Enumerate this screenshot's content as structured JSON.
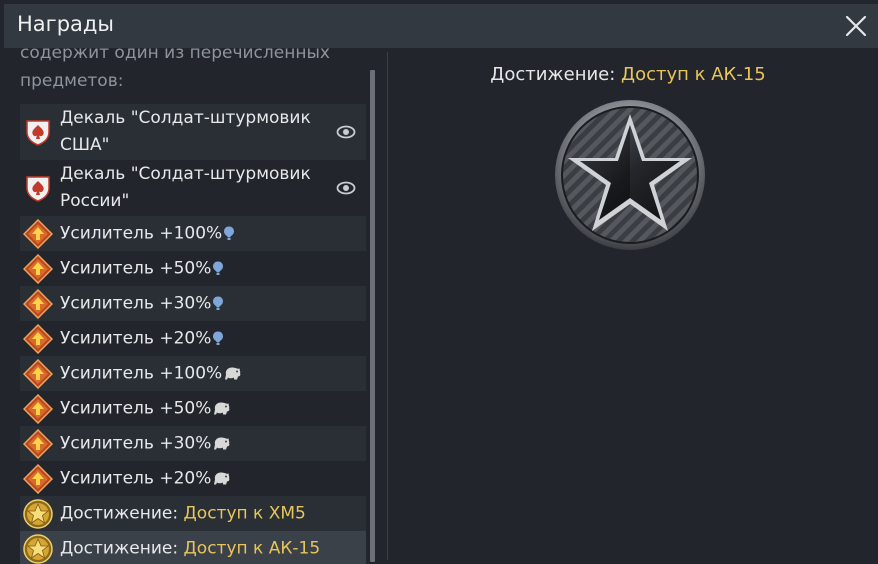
{
  "window": {
    "title": "Награды"
  },
  "intro": "содержит один из перечисленных предметов:",
  "items": [
    {
      "kind": "decal",
      "text": "Декаль \"Солдат-штурмовик США\"",
      "highlight": "",
      "suffix": "",
      "eye": true
    },
    {
      "kind": "decal",
      "text": "Декаль \"Солдат-штурмовик России\"",
      "highlight": "",
      "suffix": "",
      "eye": true
    },
    {
      "kind": "booster",
      "text": "Усилитель +100%",
      "highlight": "",
      "suffix": "rp",
      "eye": false
    },
    {
      "kind": "booster",
      "text": "Усилитель +50%",
      "highlight": "",
      "suffix": "rp",
      "eye": false
    },
    {
      "kind": "booster",
      "text": "Усилитель +30%",
      "highlight": "",
      "suffix": "rp",
      "eye": false
    },
    {
      "kind": "booster",
      "text": "Усилитель +20%",
      "highlight": "",
      "suffix": "rp",
      "eye": false
    },
    {
      "kind": "booster",
      "text": "Усилитель +100%",
      "highlight": "",
      "suffix": "lion",
      "eye": false
    },
    {
      "kind": "booster",
      "text": "Усилитель +50%",
      "highlight": "",
      "suffix": "lion",
      "eye": false
    },
    {
      "kind": "booster",
      "text": "Усилитель +30%",
      "highlight": "",
      "suffix": "lion",
      "eye": false
    },
    {
      "kind": "booster",
      "text": "Усилитель +20%",
      "highlight": "",
      "suffix": "lion",
      "eye": false
    },
    {
      "kind": "achievement",
      "text": "Достижение: ",
      "highlight": "Доступ к XM5",
      "suffix": "",
      "eye": false
    },
    {
      "kind": "achievement",
      "text": "Достижение: ",
      "highlight": "Доступ к АК-15",
      "suffix": "",
      "eye": false,
      "selected": true
    }
  ],
  "detail": {
    "prefix": "Достижение: ",
    "name": "Доступ к АК-15"
  },
  "colors": {
    "highlight": "#e8c55a",
    "rp_icon": "#7fa6d8"
  }
}
